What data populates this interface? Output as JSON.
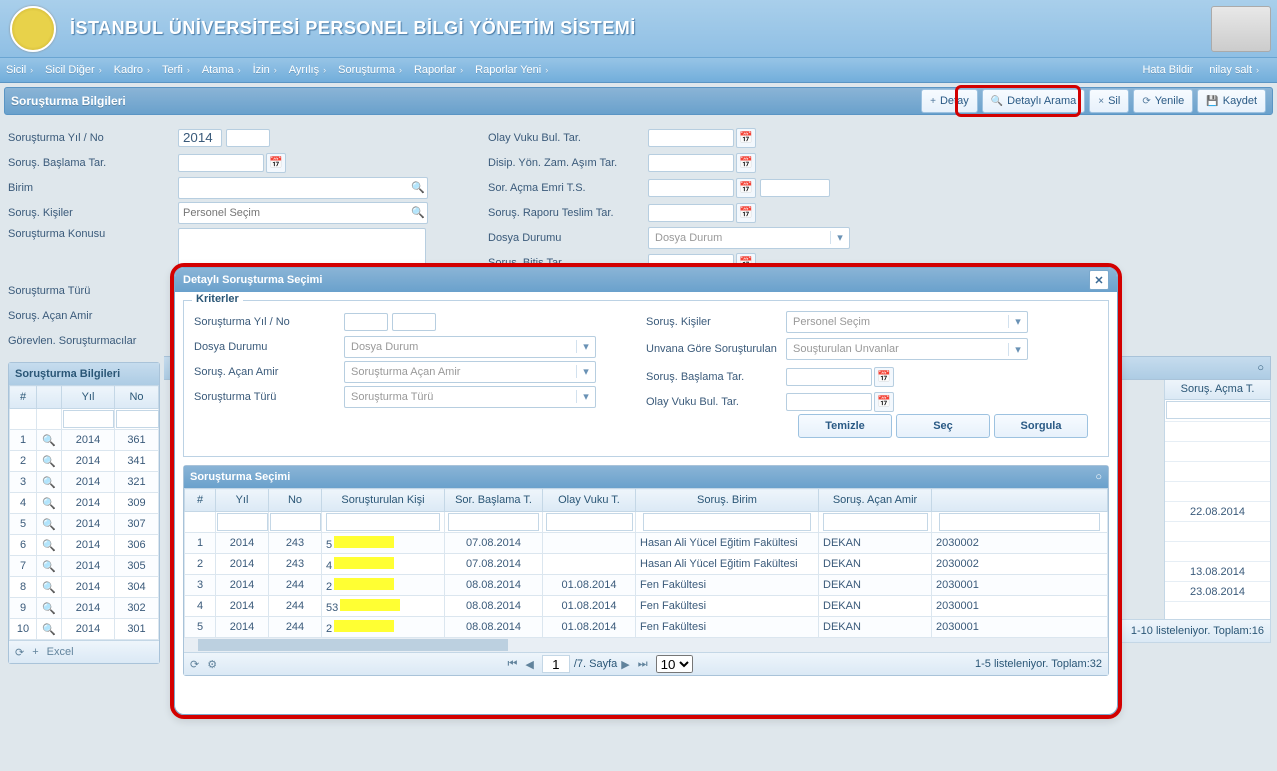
{
  "banner": {
    "title": "İSTANBUL ÜNİVERSİTESİ PERSONEL BİLGİ YÖNETİM SİSTEMİ"
  },
  "menu": {
    "items": [
      "Sicil",
      "Sicil Diğer",
      "Kadro",
      "Terfi",
      "Atama",
      "İzin",
      "Ayrılış",
      "Soruşturma",
      "Raporlar",
      "Raporlar Yeni"
    ],
    "right": {
      "report_bug": "Hata Bildir",
      "user": "nilay salt"
    }
  },
  "section": {
    "title": "Soruşturma Bilgileri"
  },
  "toolbar": {
    "detail": "Detay",
    "adv_search": "Detaylı Arama",
    "delete": "Sil",
    "refresh": "Yenile",
    "save": "Kaydet"
  },
  "form": {
    "left": {
      "year_label": "Soruşturma Yıl / No",
      "year_value": "2014",
      "start_label": "Soruş. Başlama Tar.",
      "unit_label": "Birim",
      "people_label": "Soruş. Kişiler",
      "people_placeholder": "Personel Seçim",
      "subject_label": "Soruşturma Konusu",
      "type_label": "Soruşturma Türü",
      "amir_label": "Soruş. Açan Amir",
      "assigned_label": "Görevlen. Soruşturmacılar"
    },
    "right": {
      "event_date_label": "Olay Vuku Bul. Tar.",
      "disip_label": "Disip. Yön. Zam. Aşım Tar.",
      "soracma_label": "Sor. Açma Emri T.S.",
      "teslim_label": "Soruş. Raporu Teslim Tar.",
      "dosya_label": "Dosya Durumu",
      "dosya_placeholder": "Dosya Durum",
      "bitis_label": "Soruş. Bitiş Tar."
    }
  },
  "base_grid": {
    "title": "Soruşturma Bilgileri",
    "cols": [
      "#",
      "Yıl",
      "No"
    ],
    "far_col_header": "Soruş. Açma T.",
    "rows": [
      {
        "n": "1",
        "yil": "2014",
        "no": "361",
        "far": ""
      },
      {
        "n": "2",
        "yil": "2014",
        "no": "341",
        "far": ""
      },
      {
        "n": "3",
        "yil": "2014",
        "no": "321",
        "far": ""
      },
      {
        "n": "4",
        "yil": "2014",
        "no": "309",
        "far": ""
      },
      {
        "n": "5",
        "yil": "2014",
        "no": "307",
        "far": "22.08.2014"
      },
      {
        "n": "6",
        "yil": "2014",
        "no": "306",
        "far": ""
      },
      {
        "n": "7",
        "yil": "2014",
        "no": "305",
        "far": ""
      },
      {
        "n": "8",
        "yil": "2014",
        "no": "304",
        "far": "13.08.2014"
      },
      {
        "n": "9",
        "yil": "2014",
        "no": "302",
        "far": "23.08.2014"
      },
      {
        "n": "10",
        "yil": "2014",
        "no": "301",
        "far": ""
      }
    ],
    "pager_excel": "Excel",
    "pager_status": "1-10 listeleniyor. Toplam:16"
  },
  "modal": {
    "title": "Detaylı Soruşturma Seçimi",
    "fieldset_legend": "Kriterler",
    "labels": {
      "year": "Soruşturma Yıl / No",
      "dosya": "Dosya Durumu",
      "dosya_ph": "Dosya Durum",
      "amir": "Soruş. Açan Amir",
      "amir_ph": "Soruşturma Açan Amir",
      "type": "Soruşturma Türü",
      "type_ph": "Soruşturma Türü",
      "kisiler": "Soruş. Kişiler",
      "kisiler_ph": "Personel Seçim",
      "unvan": "Unvana Göre Soruşturulan",
      "unvan_ph": "Souşturulan Unvanlar",
      "start": "Soruş. Başlama Tar.",
      "event": "Olay Vuku Bul. Tar."
    },
    "buttons": {
      "clear": "Temizle",
      "select": "Seç",
      "query": "Sorgula"
    },
    "grid_title": "Soruşturma Seçimi",
    "grid_cols": [
      "#",
      "Yıl",
      "No",
      "Soruşturulan Kişi",
      "Sor. Başlama T.",
      "Olay Vuku T.",
      "Soruş. Birim",
      "Soruş. Açan Amir",
      ""
    ],
    "grid_rows": [
      {
        "n": "1",
        "yil": "2014",
        "no": "243",
        "kisi": "5",
        "bas": "07.08.2014",
        "olay": "",
        "birim": "Hasan Ali Yücel Eğitim Fakültesi",
        "amir": "DEKAN",
        "code": "2030002"
      },
      {
        "n": "2",
        "yil": "2014",
        "no": "243",
        "kisi": "4",
        "bas": "07.08.2014",
        "olay": "",
        "birim": "Hasan Ali Yücel Eğitim Fakültesi",
        "amir": "DEKAN",
        "code": "2030002"
      },
      {
        "n": "3",
        "yil": "2014",
        "no": "244",
        "kisi": "2",
        "bas": "08.08.2014",
        "olay": "01.08.2014",
        "birim": "Fen Fakültesi",
        "amir": "DEKAN",
        "code": "2030001"
      },
      {
        "n": "4",
        "yil": "2014",
        "no": "244",
        "kisi": "53",
        "bas": "08.08.2014",
        "olay": "01.08.2014",
        "birim": "Fen Fakültesi",
        "amir": "DEKAN",
        "code": "2030001"
      },
      {
        "n": "5",
        "yil": "2014",
        "no": "244",
        "kisi": "2",
        "bas": "08.08.2014",
        "olay": "01.08.2014",
        "birim": "Fen Fakültesi",
        "amir": "DEKAN",
        "code": "2030001"
      }
    ],
    "pager": {
      "page": "1",
      "total_pages": "/7. Sayfa",
      "page_size": "10",
      "status": "1-5 listeleniyor. Toplam:32"
    }
  }
}
